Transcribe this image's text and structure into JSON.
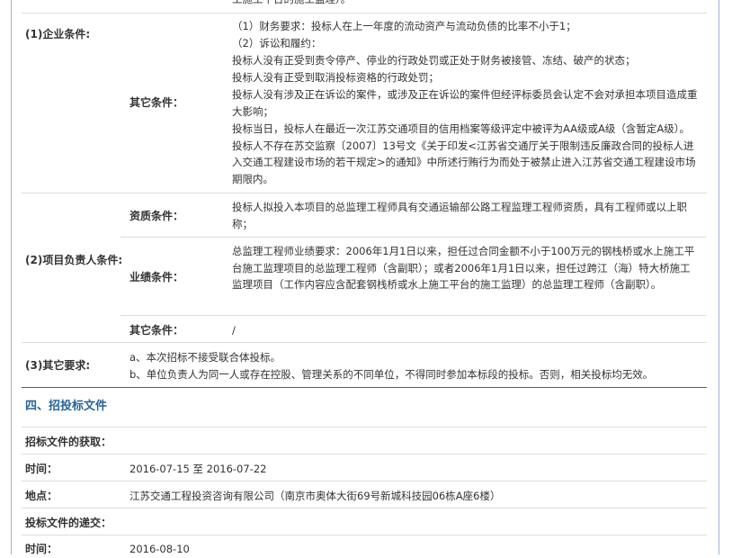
{
  "top_fragment": "工施工平台的施工监理）。",
  "enterprise": {
    "label": "(1)企业条件:",
    "other_label": "其它条件：",
    "other_lines": [
      "（1）财务要求：投标人在上一年度的流动资产与流动负债的比率不小于1；",
      "（2）诉讼和履约：",
      "投标人没有正受到责令停产、停业的行政处罚或正处于财务被接管、冻结、破产的状态；",
      "投标人没有正受到取消投标资格的行政处罚；",
      "投标人没有涉及正在诉讼的案件，或涉及正在诉讼的案件但经评标委员会认定不会对承担本项目造成重大影响；",
      "投标当日，投标人在最近一次江苏交通项目的信用档案等级评定中被评为AA级或A级（含暂定A级）。投标人不存在苏交监察〔2007〕13号文《关于印发<江苏省交通厅关于限制违反廉政合同的投标人进入交通工程建设市场的若干规定>的通知》中所述行贿行为而处于被禁止进入江苏省交通工程建设市场期限内。"
    ]
  },
  "project_lead": {
    "label": "(2)项目负责人条件:",
    "qual_label": "资质条件：",
    "qual_text": "投标人拟投入本项目的总监理工程师具有交通运输部公路工程监理工程师资质，具有工程师或以上职称；",
    "perf_label": "业绩条件：",
    "perf_text": "总监理工程师业绩要求：2006年1月1日以来，担任过合同金额不小于100万元的钢栈桥或水上施工平台施工监理项目的总监理工程师（含副职）；或者2006年1月1日以来，担任过跨江（海）特大桥施工监理项目（工作内容应含配套钢栈桥或水上施工平台的施工监理）的总监理工程师（含副职）。",
    "other_label": "其它条件：",
    "other_text": "/"
  },
  "other_req": {
    "label": "(3)其它要求:",
    "a": "a、本次招标不接受联合体投标。",
    "b": "b、单位负责人为同一人或存在控股、管理关系的不同单位，不得同时参加本标段的投标。否则，相关投标均无效。"
  },
  "section4": {
    "heading": "四、招投标文件",
    "obtain_label": "招标文件的获取：",
    "time_label": "时间：",
    "time_value": "2016-07-15 至 2016-07-22",
    "place_label": "地点：",
    "place_value": "江苏交通工程投资咨询有限公司（南京市奥体大街69号新城科技园06栋A座6楼）",
    "submit_label": "投标文件的递交：",
    "submit_time_label": "时间：",
    "submit_time_value": "2016-08-10"
  }
}
